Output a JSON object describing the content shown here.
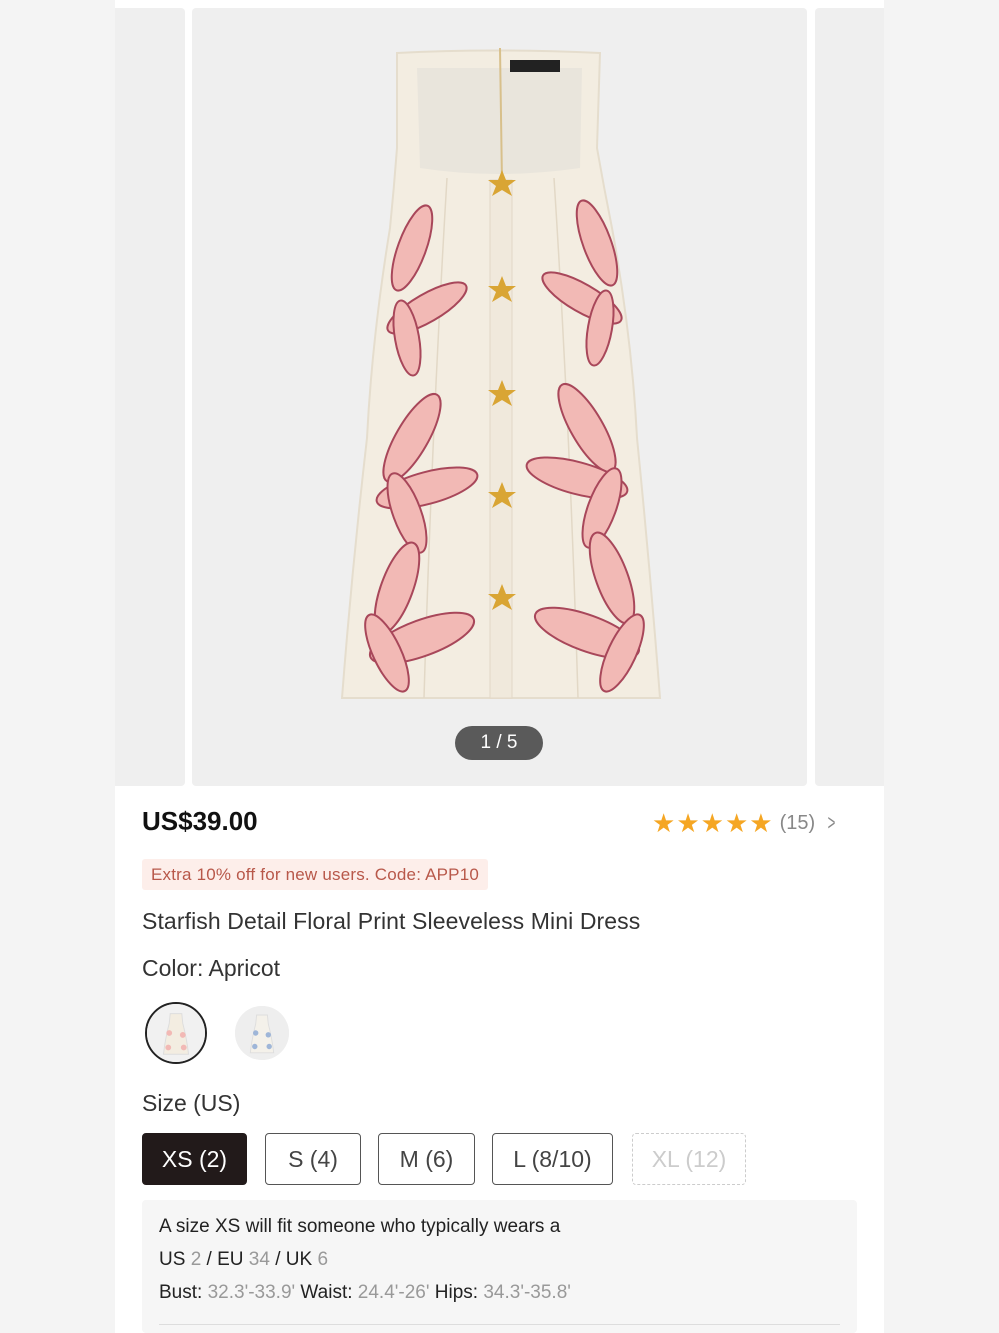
{
  "gallery": {
    "counter": "1 / 5",
    "image": "floral-starfish-dress-photo"
  },
  "product": {
    "price": "US$39.00",
    "rating": {
      "stars": 5,
      "count": "(15)"
    },
    "promo": "Extra 10% off for new users. Code: APP10",
    "title": "Starfish Detail Floral Print Sleeveless Mini Dress"
  },
  "color": {
    "label": "Color: Apricot",
    "swatches": [
      "apricot",
      "blue-print"
    ]
  },
  "size": {
    "label": "Size (US)",
    "options": [
      {
        "label": "XS (2)",
        "state": "selected"
      },
      {
        "label": "S (4)",
        "state": "available"
      },
      {
        "label": "M (6)",
        "state": "available"
      },
      {
        "label": "L (8/10)",
        "state": "available"
      },
      {
        "label": "XL (12)",
        "state": "unavailable"
      }
    ]
  },
  "fit": {
    "line1": "A size XS will fit someone who typically wears a",
    "us_label": "US",
    "us_value": "2",
    "eu_label": "EU",
    "eu_value": "34",
    "uk_label": "UK",
    "uk_value": "6",
    "bust_label": "Bust:",
    "bust_value": "32.3'-33.9'",
    "waist_label": "Waist:",
    "waist_value": "24.4'-26'",
    "hips_label": "Hips:",
    "hips_value": "34.3'-35.8'"
  },
  "colors": {
    "accent_star": "#f5a623",
    "promo_bg": "#fdeeea",
    "promo_text": "#b8584a",
    "selected_size_bg": "#221a1a"
  }
}
